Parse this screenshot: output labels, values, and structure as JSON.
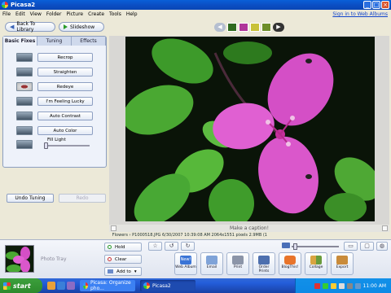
{
  "window": {
    "title": "Picasa2"
  },
  "menu": [
    "File",
    "Edit",
    "View",
    "Folder",
    "Picture",
    "Create",
    "Tools",
    "Help"
  ],
  "signin_link": "Sign in to Web Albums",
  "nav": {
    "back_label": "Back To Library",
    "slideshow_label": "Slideshow"
  },
  "edit_panel": {
    "tabs": [
      "Basic Fixes",
      "Tuning",
      "Effects"
    ],
    "tools": [
      "Recrop",
      "Straighten",
      "Redeye",
      "I'm Feeling Lucky",
      "Auto Contrast",
      "Auto Color"
    ],
    "fill_light_label": "Fill Light",
    "fill_light_value": 0,
    "undo_label": "Undo Tuning",
    "redo_label": "Redo"
  },
  "viewer": {
    "caption_placeholder": "Make a caption!",
    "info": "Flowers › P1000518.JPG    6/30/2007 10:39:08 AM    2064x1551 pixels    2.9MB    (1 of 34)"
  },
  "tray": {
    "label": "Photo Tray",
    "hold_label": "Hold",
    "clear_label": "Clear",
    "add_label": "Add to",
    "actions": [
      "Web Album",
      "Email",
      "Print",
      "Order Prints",
      "BlogThis!",
      "Collage",
      "Export"
    ],
    "web_album_badge": "New!"
  },
  "taskbar": {
    "start_label": "start",
    "tasks": [
      "Picasa: Organize pho...",
      "Picasa2"
    ],
    "clock": "11:00 AM"
  },
  "colors": {
    "titlebar": "#0b4fc4",
    "accent": "#1144cc",
    "start": "#2d8a2d"
  }
}
